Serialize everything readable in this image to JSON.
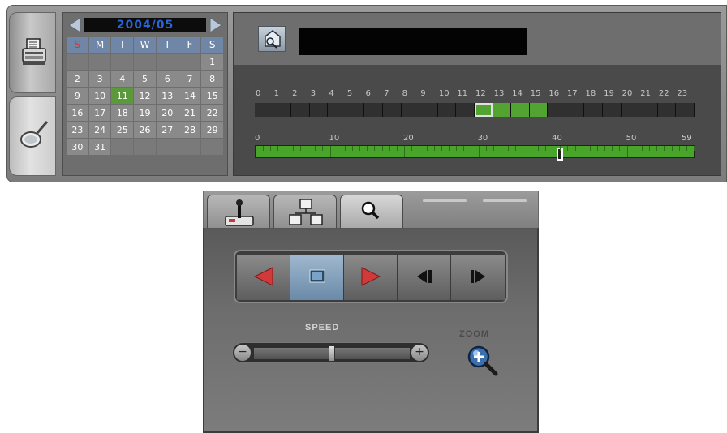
{
  "calendar": {
    "month_title": "2004/05",
    "day_headers": [
      "S",
      "M",
      "T",
      "W",
      "T",
      "F",
      "S"
    ],
    "weeks": [
      [
        "",
        "",
        "",
        "",
        "",
        "",
        "1"
      ],
      [
        "2",
        "3",
        "4",
        "5",
        "6",
        "7",
        "8"
      ],
      [
        "9",
        "10",
        "11",
        "12",
        "13",
        "14",
        "15"
      ],
      [
        "16",
        "17",
        "18",
        "19",
        "20",
        "21",
        "22"
      ],
      [
        "23",
        "24",
        "25",
        "26",
        "27",
        "28",
        "29"
      ],
      [
        "30",
        "31",
        "",
        "",
        "",
        "",
        ""
      ]
    ],
    "selected_day": "11"
  },
  "timeline": {
    "hour_labels": [
      "0",
      "1",
      "2",
      "3",
      "4",
      "5",
      "6",
      "7",
      "8",
      "9",
      "10",
      "11",
      "12",
      "13",
      "14",
      "15",
      "16",
      "17",
      "18",
      "19",
      "20",
      "21",
      "22",
      "23"
    ],
    "recorded_hours": [
      12,
      13,
      14,
      15
    ],
    "current_hour": 12,
    "minute_labels": [
      "0",
      "10",
      "20",
      "30",
      "40",
      "50",
      "59"
    ],
    "current_minute": 41
  },
  "left_rail": {
    "icons": [
      "fax-machine-icon",
      "magnifier-search-icon"
    ]
  },
  "control_panel": {
    "tabs": [
      {
        "icon": "joystick-icon",
        "active": false
      },
      {
        "icon": "network-icon",
        "active": false
      },
      {
        "icon": "search-icon",
        "active": true
      }
    ],
    "transport": [
      "rewind",
      "stop",
      "play",
      "step-back",
      "step-forward"
    ],
    "active_transport": "stop",
    "speed_label": "SPEED",
    "speed_level": 0.5,
    "zoom_label": "ZOOM"
  },
  "colors": {
    "recorded": "#52a332",
    "selected_day": "#5a9a3a",
    "title_blue": "#2a64d8",
    "arrow_red": "#d03a3a"
  }
}
